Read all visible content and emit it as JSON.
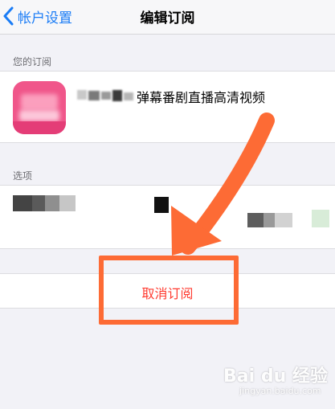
{
  "navbar": {
    "back_label": "帐户设置",
    "title": "编辑订阅"
  },
  "subscription_section": {
    "header": "您的订阅",
    "item_name": "弹幕番剧直播高清视频"
  },
  "options_section": {
    "header": "选项"
  },
  "cancel_button": {
    "label": "取消订阅"
  },
  "annotation": {
    "color": "#fd6b35"
  },
  "watermark": {
    "brand": "Bai du 经验",
    "url": "jingyan.baidu.com"
  },
  "colors": {
    "link_blue": "#1a7cf6",
    "destructive_red": "#ff3b30",
    "app_icon_pink": "#f0568a"
  }
}
